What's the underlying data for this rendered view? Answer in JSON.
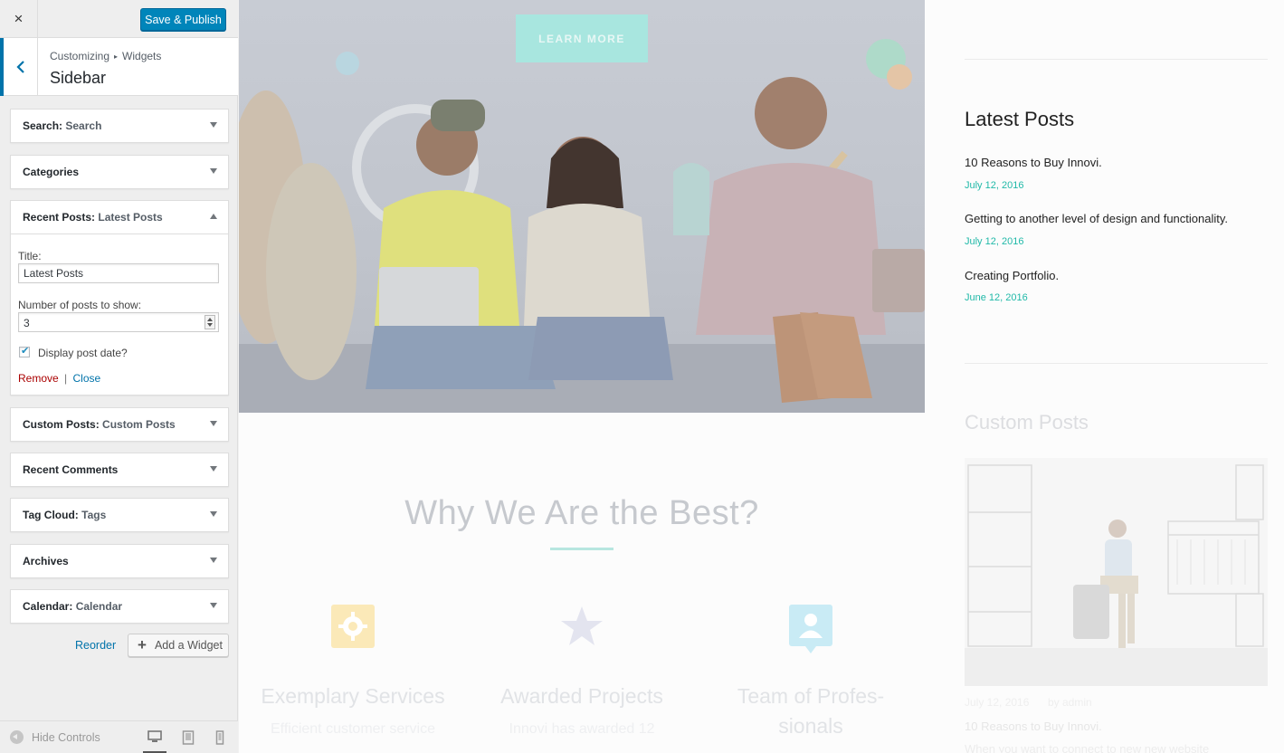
{
  "customizer": {
    "close_label": "×",
    "save_label": "Save & Publish",
    "breadcrumb": {
      "part1": "Customizing",
      "separator": "▸",
      "part2": "Widgets"
    },
    "section_title": "Sidebar",
    "widgets": [
      {
        "name": "Search",
        "instance": "Search",
        "expanded": false
      },
      {
        "name": "Categories",
        "instance": "",
        "expanded": false
      },
      {
        "name": "Recent Posts",
        "instance": "Latest Posts",
        "expanded": true
      },
      {
        "name": "Custom Posts",
        "instance": "Custom Posts",
        "expanded": false
      },
      {
        "name": "Recent Comments",
        "instance": "",
        "expanded": false
      },
      {
        "name": "Tag Cloud",
        "instance": "Tags",
        "expanded": false
      },
      {
        "name": "Archives",
        "instance": "",
        "expanded": false
      },
      {
        "name": "Calendar",
        "instance": "Calendar",
        "expanded": false
      }
    ],
    "recent_posts_form": {
      "title_label": "Title:",
      "title_value": "Latest Posts",
      "number_label": "Number of posts to show:",
      "number_value": "3",
      "show_date_label": "Display post date?",
      "show_date_checked": true,
      "remove_label": "Remove",
      "separator": "|",
      "close_label": "Close"
    },
    "reorder_label": "Reorder",
    "add_widget_label": "Add a Widget",
    "add_widget_icon": "+",
    "hide_controls_label": "Hide Controls",
    "devices": [
      "desktop-icon",
      "tablet-icon",
      "mobile-icon"
    ],
    "active_device": "desktop"
  },
  "preview": {
    "hero": {
      "button_label": "LEARN MORE"
    },
    "why": {
      "title": "Why We Are the Best?",
      "features": [
        {
          "icon": "gear-icon",
          "color": "#fbe9b8",
          "title_line1": "Exemplary Services",
          "title_line2": "",
          "subtitle": "Efficient customer service"
        },
        {
          "icon": "star-icon",
          "color": "#e3e4ef",
          "title_line1": "Awarded Projects",
          "title_line2": "",
          "subtitle": "Innovi has awarded 12"
        },
        {
          "icon": "user-card-icon",
          "color": "#c9ebf5",
          "title_line1": "Team of Profes-",
          "title_line2": "sionals",
          "subtitle": ""
        }
      ]
    },
    "sidebar": {
      "latest_title": "Latest Posts",
      "posts": [
        {
          "title": "10 Reasons to Buy Innovi.",
          "date": "July 12, 2016"
        },
        {
          "title": "Getting to another level of design and functionality.",
          "date": "July 12, 2016"
        },
        {
          "title": "Creating Portfolio.",
          "date": "June 12, 2016"
        }
      ],
      "custom_title": "Custom Posts",
      "custom_meta_date": "July 12, 2016",
      "custom_meta_author": "by admin",
      "custom_post_title": "10 Reasons to Buy Innovi.",
      "custom_post_excerpt": "When you want to connect to new new website"
    },
    "colors": {
      "accent": "#20b9a8",
      "wp_blue": "#0085ba"
    }
  }
}
